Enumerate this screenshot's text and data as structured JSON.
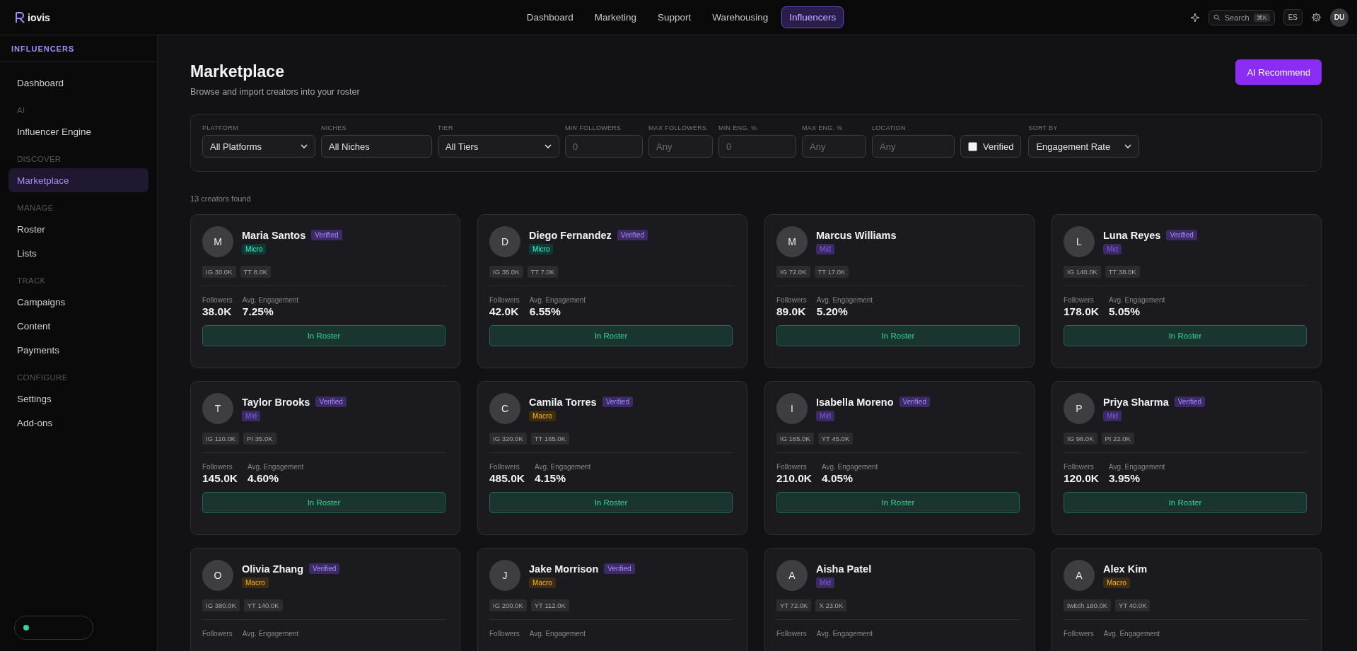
{
  "topbar": {
    "logo": "iovis",
    "nav": [
      {
        "label": "Dashboard",
        "selected": false
      },
      {
        "label": "Marketing",
        "selected": false
      },
      {
        "label": "Support",
        "selected": false
      },
      {
        "label": "Warehousing",
        "selected": false
      },
      {
        "label": "Influencers",
        "selected": true
      }
    ],
    "search": {
      "label": "Search",
      "shortcut": "⌘K"
    },
    "language": "ES",
    "avatar": "DU"
  },
  "sidebar": {
    "title": "INFLUENCERS",
    "items": [
      {
        "kind": "link",
        "label": "Dashboard",
        "selected": false
      },
      {
        "kind": "heading",
        "label": "AI"
      },
      {
        "kind": "link",
        "label": "Influencer Engine",
        "selected": false
      },
      {
        "kind": "heading",
        "label": "DISCOVER"
      },
      {
        "kind": "link",
        "label": "Marketplace",
        "selected": true
      },
      {
        "kind": "heading",
        "label": "MANAGE"
      },
      {
        "kind": "link",
        "label": "Roster",
        "selected": false
      },
      {
        "kind": "link",
        "label": "Lists",
        "selected": false
      },
      {
        "kind": "heading",
        "label": "TRACK"
      },
      {
        "kind": "link",
        "label": "Campaigns",
        "selected": false
      },
      {
        "kind": "link",
        "label": "Content",
        "selected": false
      },
      {
        "kind": "link",
        "label": "Payments",
        "selected": false
      },
      {
        "kind": "heading",
        "label": "CONFIGURE"
      },
      {
        "kind": "link",
        "label": "Settings",
        "selected": false
      },
      {
        "kind": "link",
        "label": "Add-ons",
        "selected": false
      }
    ]
  },
  "page": {
    "title": "Marketplace",
    "subtitle": "Browse and import creators into your roster",
    "action": "AI Recommend"
  },
  "filters": [
    {
      "kind": "select",
      "label": "PLATFORM",
      "value": "All Platforms"
    },
    {
      "kind": "input",
      "label": "NICHES",
      "value": "All Niches"
    },
    {
      "kind": "select",
      "label": "TIER",
      "value": "All Tiers"
    },
    {
      "kind": "input",
      "label": "MIN FOLLOWERS",
      "placeholder": "0"
    },
    {
      "kind": "input",
      "label": "MAX FOLLOWERS",
      "placeholder": "Any"
    },
    {
      "kind": "input",
      "label": "MIN ENG. %",
      "placeholder": "0"
    },
    {
      "kind": "input",
      "label": "MAX ENG. %",
      "placeholder": "Any"
    },
    {
      "kind": "input",
      "label": "LOCATION",
      "placeholder": "Any"
    },
    {
      "kind": "checkbox",
      "label": "Verified",
      "checked": false
    },
    {
      "kind": "select",
      "label": "SORT BY",
      "value": "Engagement Rate"
    }
  ],
  "result_count": "13 creators found",
  "creators": [
    {
      "initial": "M",
      "name": "Maria Santos",
      "verified": true,
      "verified_label": "Verified",
      "tier": "Micro",
      "color": "#0f3a34",
      "platforms": [
        "IG 30.0K",
        "TT 8.0K"
      ],
      "followers_label": "Followers",
      "followers": "38.0K",
      "engagement_label": "Avg. Engagement",
      "engagement": "7.25%",
      "button": "In Roster"
    },
    {
      "initial": "D",
      "name": "Diego Fernandez",
      "verified": true,
      "verified_label": "Verified",
      "tier": "Micro",
      "color": "#0f3a34",
      "platforms": [
        "IG 35.0K",
        "TT 7.0K"
      ],
      "followers_label": "Followers",
      "followers": "42.0K",
      "engagement_label": "Avg. Engagement",
      "engagement": "6.55%",
      "button": "In Roster"
    },
    {
      "initial": "M",
      "name": "Marcus Williams",
      "verified": false,
      "tier": "Mid",
      "color": "#3b2a63",
      "platforms": [
        "IG 72.0K",
        "TT 17.0K"
      ],
      "followers_label": "Followers",
      "followers": "89.0K",
      "engagement_label": "Avg. Engagement",
      "engagement": "5.20%",
      "button": "In Roster"
    },
    {
      "initial": "L",
      "name": "Luna Reyes",
      "verified": true,
      "verified_label": "Verified",
      "tier": "Mid",
      "color": "#3b2a63",
      "platforms": [
        "IG 140.0K",
        "TT 38.0K"
      ],
      "followers_label": "Followers",
      "followers": "178.0K",
      "engagement_label": "Avg. Engagement",
      "engagement": "5.05%",
      "button": "In Roster"
    },
    {
      "initial": "T",
      "name": "Taylor Brooks",
      "verified": true,
      "verified_label": "Verified",
      "tier": "Mid",
      "color": "#3b2a63",
      "platforms": [
        "IG 110.0K",
        "PI 35.0K"
      ],
      "followers_label": "Followers",
      "followers": "145.0K",
      "engagement_label": "Avg. Engagement",
      "engagement": "4.60%",
      "button": "In Roster"
    },
    {
      "initial": "C",
      "name": "Camila Torres",
      "verified": true,
      "verified_label": "Verified",
      "tier": "Macro",
      "color": "#3d2c0e",
      "platforms": [
        "IG 320.0K",
        "TT 165.0K"
      ],
      "followers_label": "Followers",
      "followers": "485.0K",
      "engagement_label": "Avg. Engagement",
      "engagement": "4.15%",
      "button": "In Roster"
    },
    {
      "initial": "I",
      "name": "Isabella Moreno",
      "verified": true,
      "verified_label": "Verified",
      "tier": "Mid",
      "color": "#3b2a63",
      "platforms": [
        "IG 165.0K",
        "YT 45.0K"
      ],
      "followers_label": "Followers",
      "followers": "210.0K",
      "engagement_label": "Avg. Engagement",
      "engagement": "4.05%",
      "button": "In Roster"
    },
    {
      "initial": "P",
      "name": "Priya Sharma",
      "verified": true,
      "verified_label": "Verified",
      "tier": "Mid",
      "color": "#3b2a63",
      "platforms": [
        "IG 98.0K",
        "PI 22.0K"
      ],
      "followers_label": "Followers",
      "followers": "120.0K",
      "engagement_label": "Avg. Engagement",
      "engagement": "3.95%",
      "button": "In Roster"
    },
    {
      "initial": "O",
      "name": "Olivia Zhang",
      "verified": true,
      "verified_label": "Verified",
      "tier": "Macro",
      "color": "#3d2c0e",
      "platforms": [
        "IG 380.0K",
        "YT 140.0K"
      ],
      "followers_label": "Followers",
      "engagement_label": "Avg. Engagement"
    },
    {
      "initial": "J",
      "name": "Jake Morrison",
      "verified": true,
      "verified_label": "Verified",
      "tier": "Macro",
      "color": "#3d2c0e",
      "platforms": [
        "IG 200.0K",
        "YT 112.0K"
      ],
      "followers_label": "Followers",
      "engagement_label": "Avg. Engagement"
    },
    {
      "initial": "A",
      "name": "Aisha Patel",
      "verified": false,
      "tier": "Mid",
      "color": "#3b2a63",
      "platforms": [
        "YT 72.0K",
        "X 23.0K"
      ],
      "followers_label": "Followers",
      "engagement_label": "Avg. Engagement"
    },
    {
      "initial": "A",
      "name": "Alex Kim",
      "verified": false,
      "tier": "Macro",
      "color": "#3d2c0e",
      "platforms": [
        "twitch 180.0K",
        "YT 40.0K"
      ],
      "followers_label": "Followers",
      "engagement_label": "Avg. Engagement"
    }
  ]
}
